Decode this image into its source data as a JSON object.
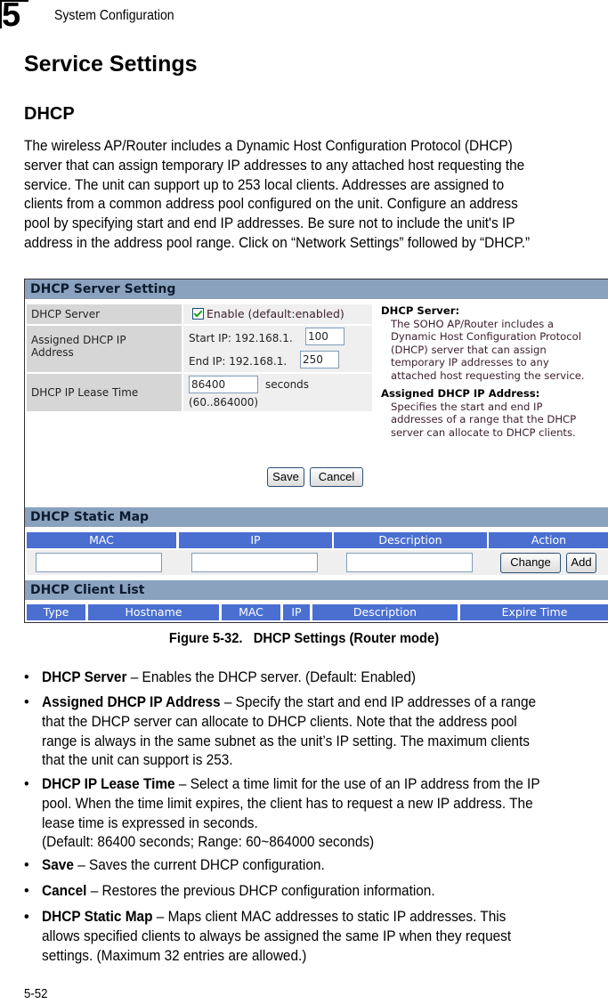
{
  "header": {
    "chapter_number": "5",
    "running_title": "System Configuration"
  },
  "page": {
    "heading": "Service Settings",
    "subheading": "DHCP",
    "intro_lines": [
      "The wireless AP/Router includes a Dynamic Host Configuration Protocol (DHCP)",
      "server that can assign temporary IP addresses to any attached host requesting the",
      "service. The unit can support up to 253 local clients. Addresses are assigned to",
      "clients from a common address pool configured on the unit. Configure an address",
      "pool by specifying start and end IP addresses. Be sure not to include the unit's IP",
      "address in the address pool range. Click on “Network Settings” followed by “DHCP.”"
    ],
    "page_number": "5-52"
  },
  "figure": {
    "server_setting": {
      "title": "DHCP Server Setting",
      "dhcp_server_label": "DHCP Server",
      "enable_checked": true,
      "enable_label": "Enable (default:enabled)",
      "assigned_label_line1": "Assigned DHCP IP",
      "assigned_label_line2": "Address",
      "start_ip_prefix": "Start IP: 192.168.1.",
      "start_ip_value": "100",
      "end_ip_prefix": "End IP: 192.168.1.",
      "end_ip_value": "250",
      "lease_label": "DHCP IP Lease Time",
      "lease_value": "86400",
      "lease_unit": "seconds",
      "lease_range": "(60..864000)",
      "save_label": "Save",
      "cancel_label": "Cancel"
    },
    "help": {
      "server_title": "DHCP Server:",
      "server_lines": [
        "The SOHO AP/Router includes a",
        "Dynamic Host Configuration Protocol",
        "(DHCP) server that can assign",
        "temporary IP addresses to any",
        "attached host requesting the service."
      ],
      "assigned_title": "Assigned DHCP IP Address:",
      "assigned_lines": [
        "Specifies the start and end IP",
        "addresses of a range that the DHCP",
        "server can allocate to DHCP clients."
      ]
    },
    "static_map": {
      "title": "DHCP Static Map",
      "columns": [
        "MAC",
        "IP",
        "Description",
        "Action"
      ],
      "mac_value": "",
      "ip_value": "",
      "description_value": "",
      "change_label": "Change",
      "add_label": "Add"
    },
    "client_list": {
      "title": "DHCP Client List",
      "columns": [
        "Type",
        "Hostname",
        "MAC",
        "IP",
        "Description",
        "Expire Time"
      ]
    },
    "caption": "Figure 5-32.   DHCP Settings (Router mode)"
  },
  "bullets": [
    {
      "term": "DHCP Server",
      "lines": [
        " – Enables the DHCP server. (Default: Enabled)"
      ]
    },
    {
      "term": "Assigned DHCP IP Address",
      "lines": [
        " – Specify the start and end IP addresses of a range",
        "that the DHCP server can allocate to DHCP clients. Note that the address pool",
        "range is always in the same subnet as the unit’s IP setting. The maximum clients",
        "that the unit can support is 253."
      ]
    },
    {
      "term": "DHCP IP Lease Time",
      "lines": [
        " – Select a time limit for the use of an IP address from the IP",
        "pool. When the time limit expires, the client has to request a new IP address. The",
        "lease time is expressed in seconds.",
        "(Default: 86400 seconds; Range: 60~864000 seconds)"
      ]
    },
    {
      "term": "Save",
      "lines": [
        " – Saves the current DHCP configuration."
      ]
    },
    {
      "term": "Cancel",
      "lines": [
        " – Restores the previous DHCP configuration information."
      ]
    },
    {
      "term": "DHCP Static Map",
      "lines": [
        " – Maps client MAC addresses to static IP addresses. This",
        "allows specified clients to always be assigned the same IP when they request",
        "settings. (Maximum 32 entries are allowed.)"
      ]
    }
  ],
  "bullet_glyph": "•"
}
